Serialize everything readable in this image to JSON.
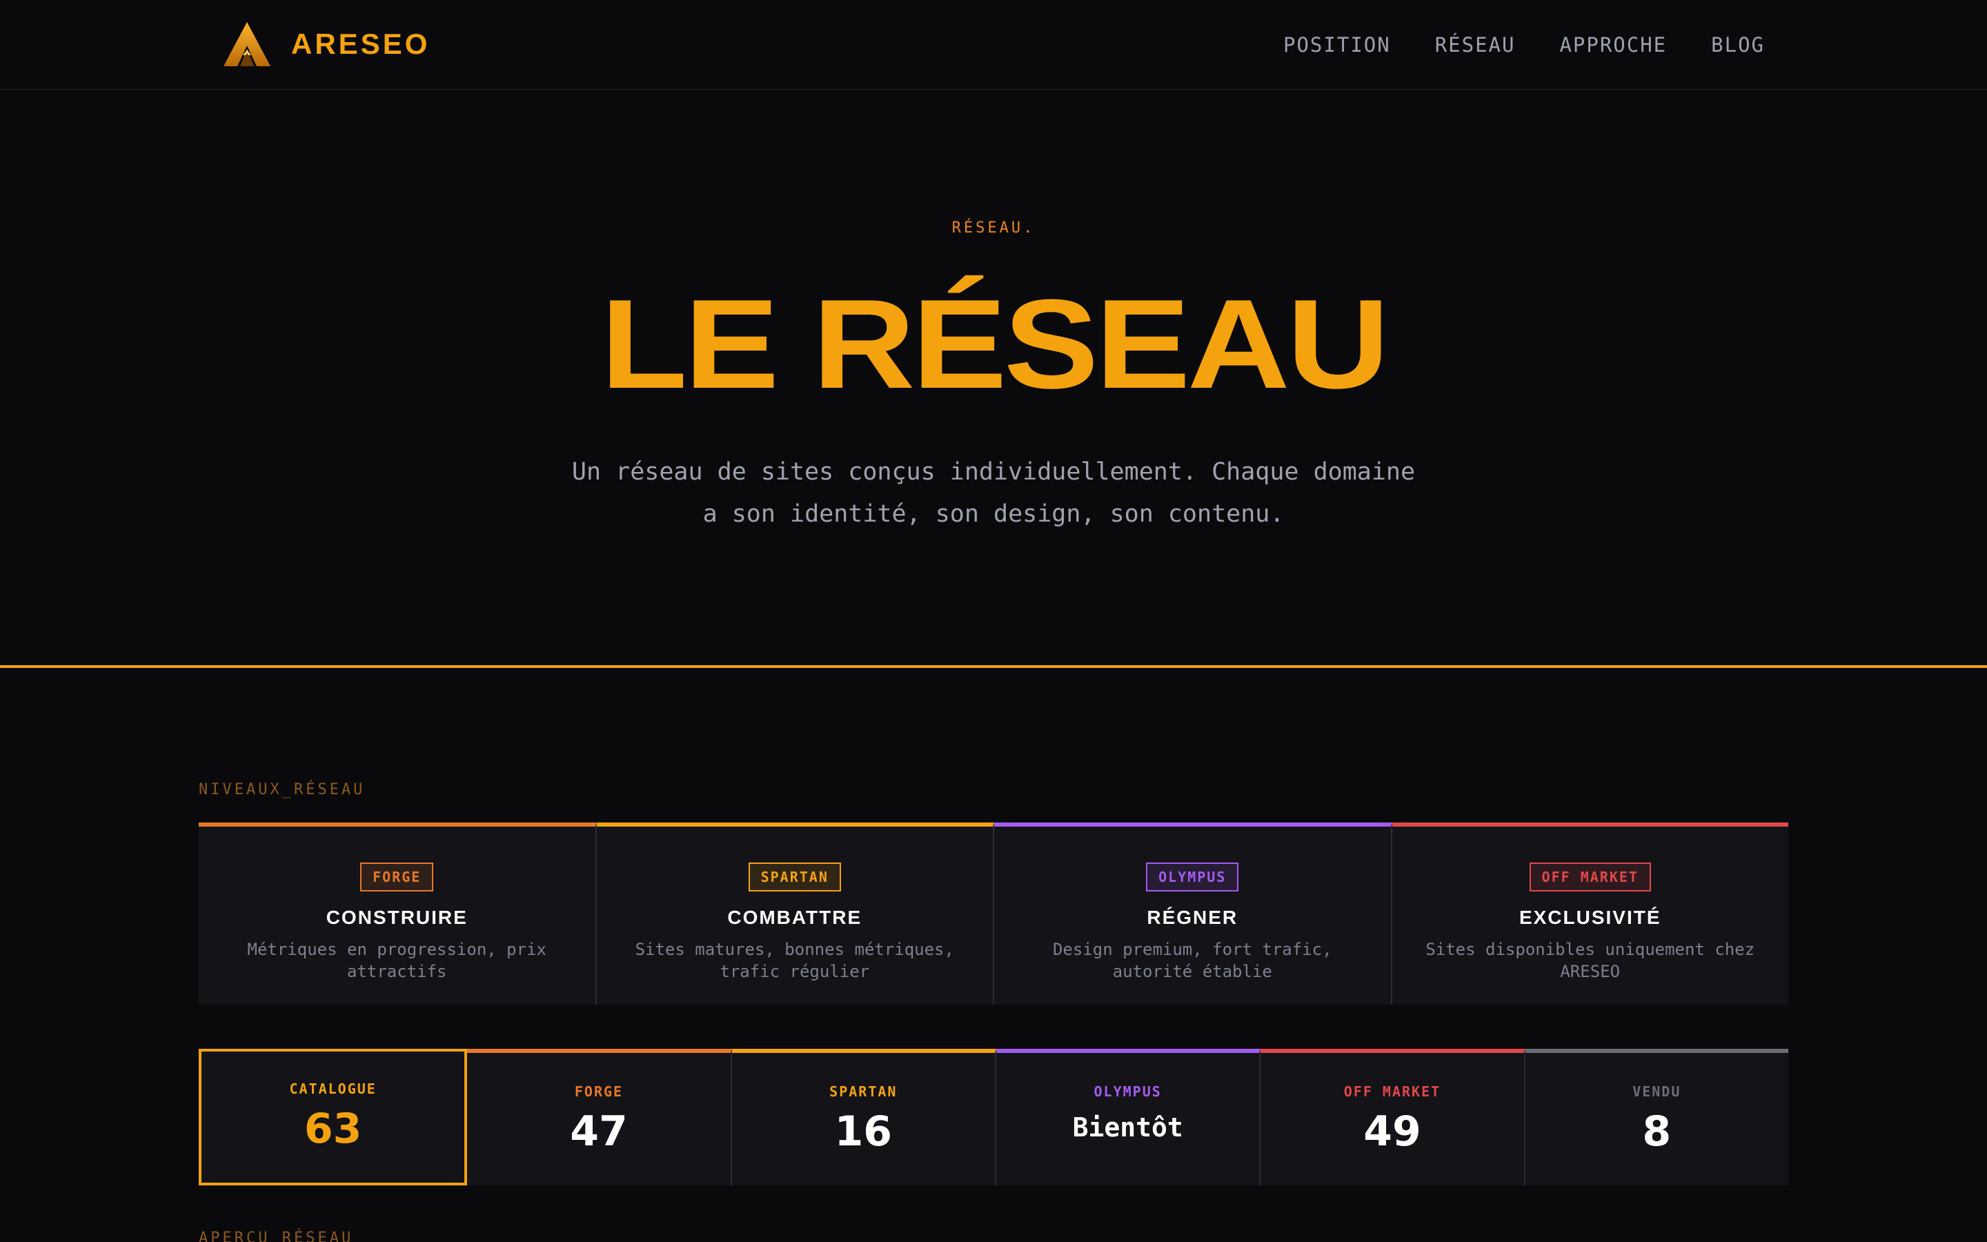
{
  "nav": {
    "brand": "ARESEO",
    "links": [
      "POSITION",
      "RÉSEAU",
      "APPROCHE",
      "BLOG"
    ]
  },
  "hero": {
    "eyebrow": "RÉSEAU.",
    "title": "LE RÉSEAU",
    "subtitle_line1": "Un réseau de sites conçus individuellement. Chaque domaine",
    "subtitle_line2": "a son identité, son design, son contenu."
  },
  "tiers_section": {
    "label": "NIVEAUX_RÉSEAU",
    "tiers": [
      {
        "badge": "FORGE",
        "title": "CONSTRUIRE",
        "desc": "Métriques en progression, prix attractifs",
        "color": "#e8782a"
      },
      {
        "badge": "SPARTAN",
        "title": "COMBATTRE",
        "desc": "Sites matures, bonnes métriques, trafic régulier",
        "color": "#f5a20f"
      },
      {
        "badge": "OLYMPUS",
        "title": "RÉGNER",
        "desc": "Design premium, fort trafic, autorité établie",
        "color": "#a45cf0"
      },
      {
        "badge": "OFF MARKET",
        "title": "EXCLUSIVITÉ",
        "desc": "Sites disponibles uniquement chez ARESEO",
        "color": "#e0484b"
      }
    ]
  },
  "stats": [
    {
      "label": "CATALOGUE",
      "value": "63",
      "color": "#f5a20f",
      "active": true
    },
    {
      "label": "FORGE",
      "value": "47",
      "color": "#e8782a"
    },
    {
      "label": "SPARTAN",
      "value": "16",
      "color": "#f5a20f"
    },
    {
      "label": "OLYMPUS",
      "value": "Bientôt",
      "color": "#a45cf0"
    },
    {
      "label": "OFF MARKET",
      "value": "49",
      "color": "#e0484b"
    },
    {
      "label": "VENDU",
      "value": "8",
      "color": "#6b6e78"
    }
  ],
  "overview_section": {
    "label": "APERÇU_RÉSEAU"
  },
  "colors": {
    "accent": "#f5a20f",
    "background": "#0a0a0c",
    "card": "#131318"
  }
}
